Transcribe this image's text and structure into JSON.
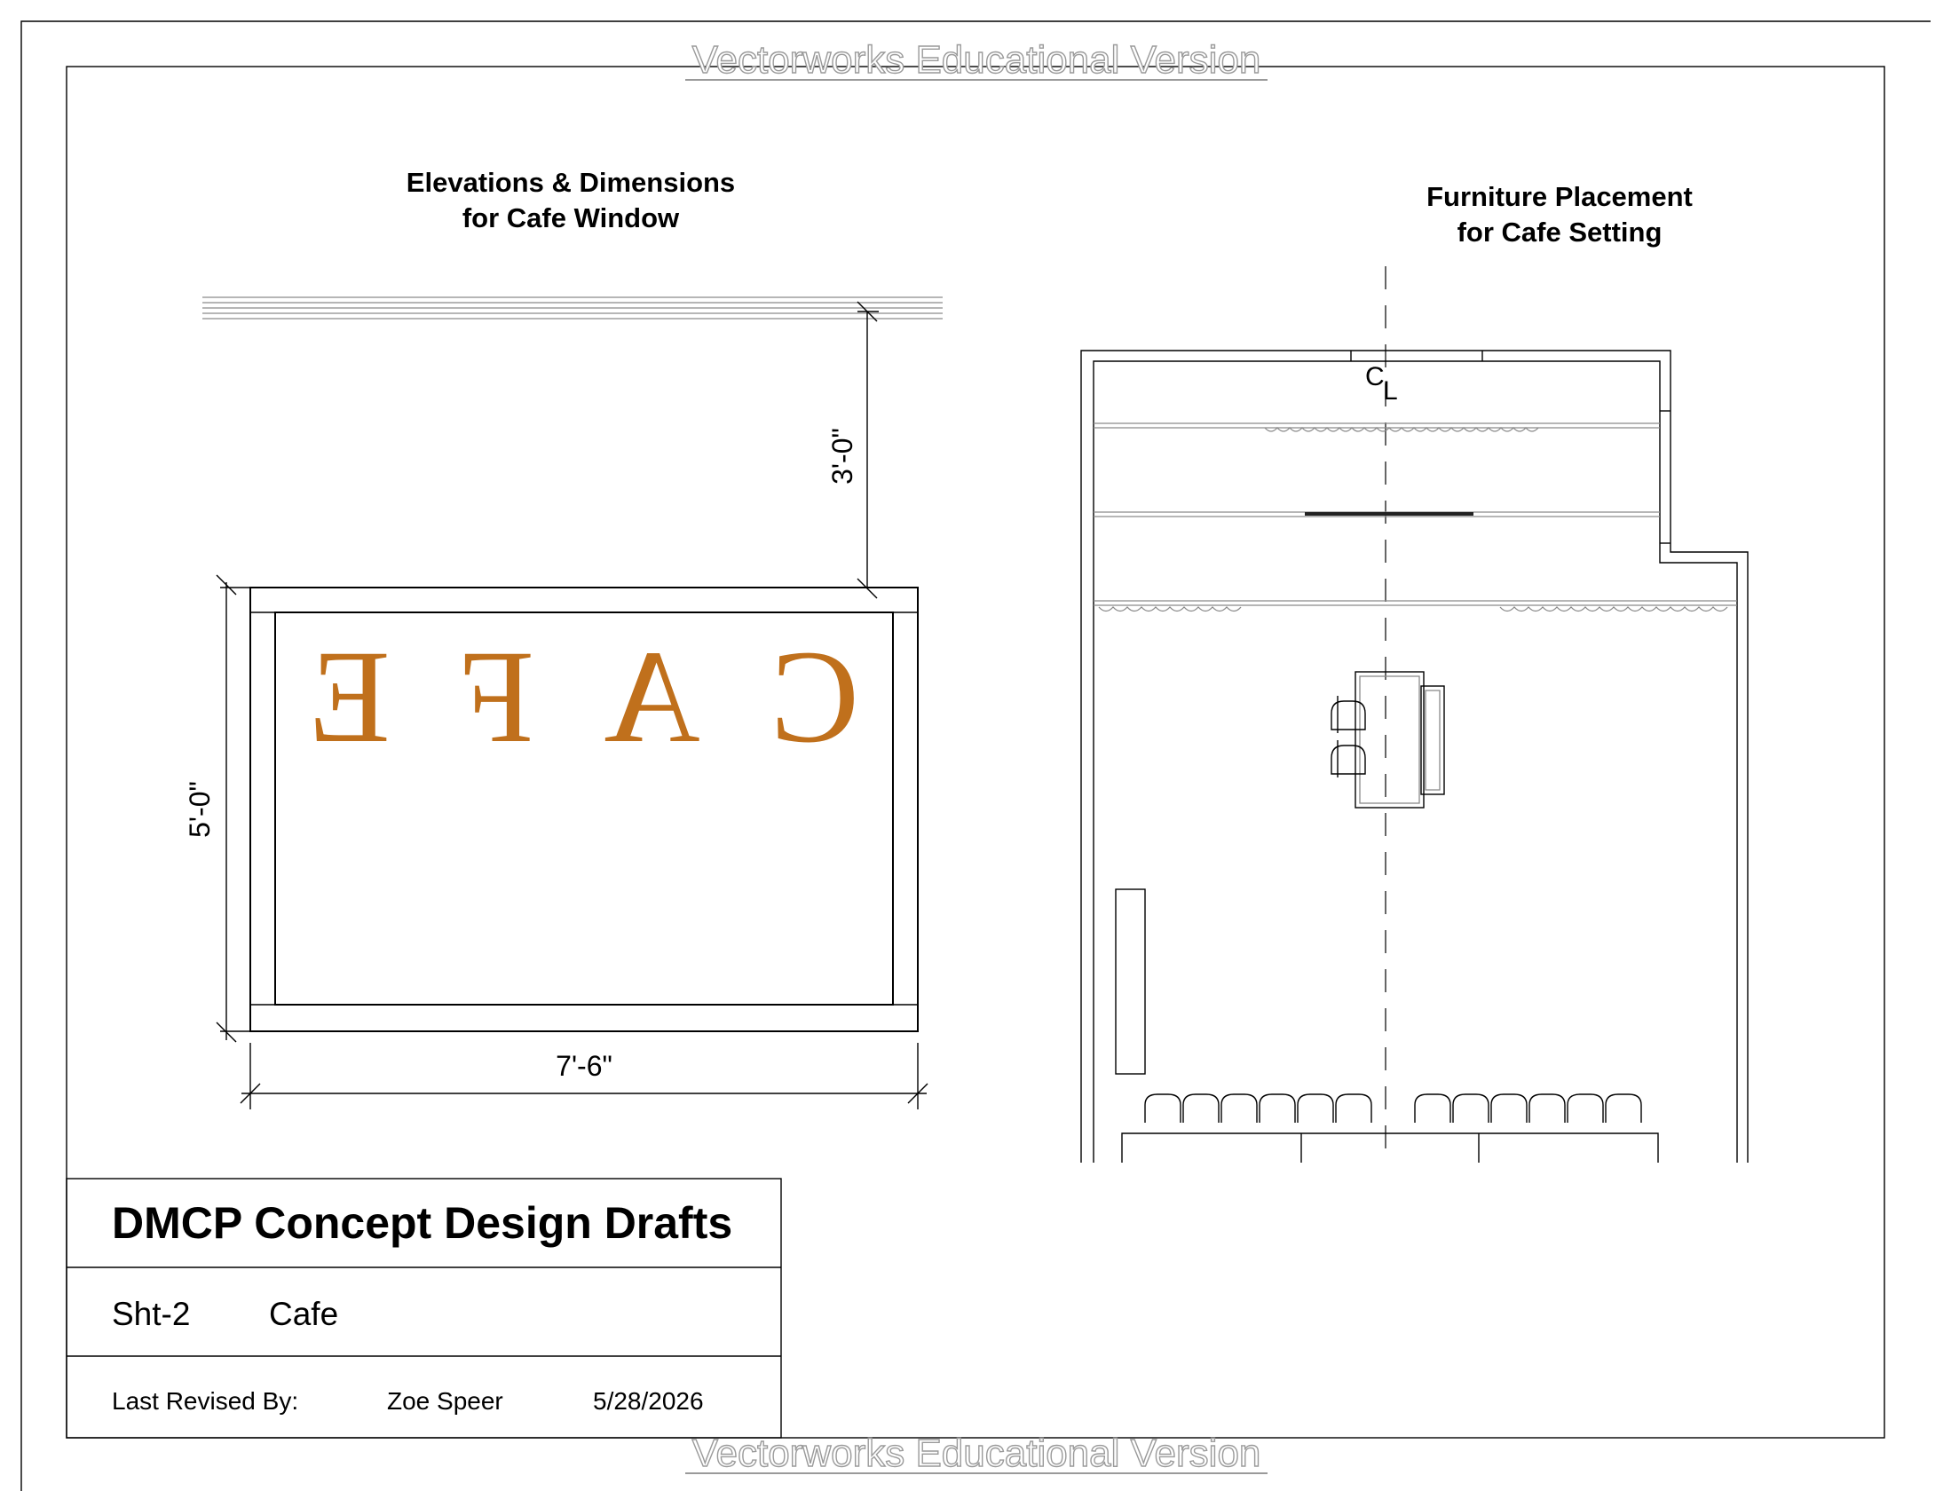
{
  "watermark": "Vectorworks Educational Version",
  "elevation": {
    "title_line1": "Elevations & Dimensions",
    "title_line2": "for Cafe Window",
    "sign_text": "CAFE",
    "sign_color": "#c0701c",
    "dim_top": "3'-0\"",
    "dim_height": "5'-0\"",
    "dim_width": "7'-6\""
  },
  "plan": {
    "title_line1": "Furniture Placement",
    "title_line2": "for Cafe Setting",
    "centerline_c": "C",
    "centerline_l": "L"
  },
  "title_block": {
    "project": "DMCP Concept Design Drafts",
    "sheet_number": "Sht-2",
    "sheet_name": "Cafe",
    "revised_label": "Last Revised By:",
    "revised_by": "Zoe Speer",
    "revised_date": "5/28/2026"
  }
}
